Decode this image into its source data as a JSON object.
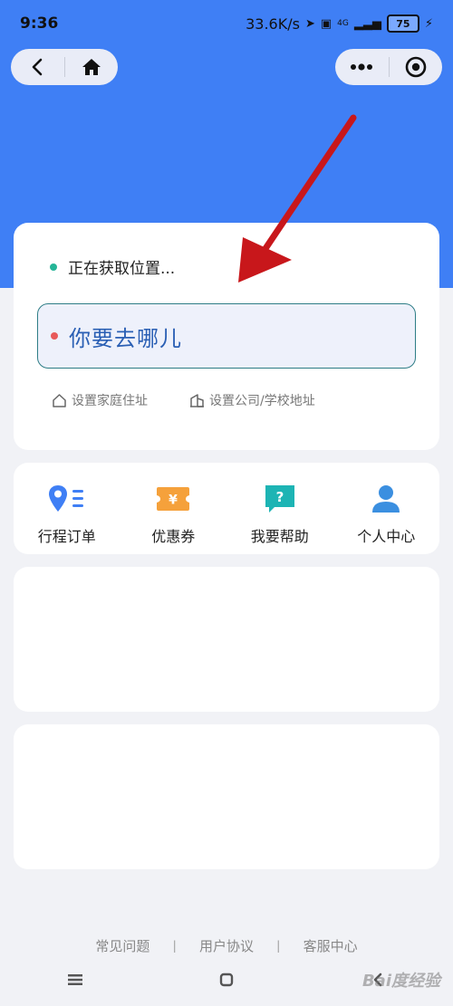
{
  "status_bar": {
    "time": "9:36",
    "net_speed": "33.6K/s",
    "network": "4G",
    "battery": "75"
  },
  "colors": {
    "hero_blue": "#3f7ff5",
    "input_text": "#2a5fb4",
    "status_dot": "#25b597",
    "dest_dot": "#e85a5a",
    "arrow": "#c8171b"
  },
  "location": {
    "status": "正在获取位置...",
    "destination_placeholder": "你要去哪儿",
    "shortcuts": [
      {
        "label": "设置家庭住址",
        "icon": "home-icon"
      },
      {
        "label": "设置公司/学校地址",
        "icon": "building-icon"
      }
    ]
  },
  "menu": [
    {
      "label": "行程订单",
      "icon": "trip-order-icon"
    },
    {
      "label": "优惠券",
      "icon": "coupon-icon"
    },
    {
      "label": "我要帮助",
      "icon": "help-icon"
    },
    {
      "label": "个人中心",
      "icon": "user-icon"
    }
  ],
  "footer": {
    "links": [
      "常见问题",
      "用户协议",
      "客服中心"
    ]
  },
  "watermark": "Bai度经验"
}
